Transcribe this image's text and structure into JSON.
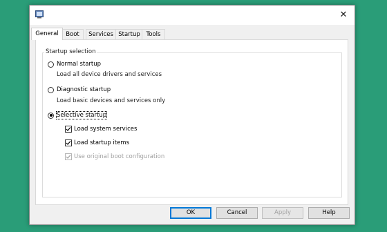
{
  "window": {
    "close_glyph": "✕"
  },
  "tabs": [
    {
      "label": "General",
      "active": true
    },
    {
      "label": "Boot",
      "active": false
    },
    {
      "label": "Services",
      "active": false
    },
    {
      "label": "Startup",
      "active": false
    },
    {
      "label": "Tools",
      "active": false
    }
  ],
  "startup_selection": {
    "group_title": "Startup selection",
    "normal": {
      "label": "Normal startup",
      "description": "Load all device drivers and services",
      "selected": false
    },
    "diagnostic": {
      "label": "Diagnostic startup",
      "description": "Load basic devices and services only",
      "selected": false
    },
    "selective": {
      "label": "Selective startup",
      "selected": true
    },
    "options": {
      "load_system_services": {
        "label": "Load system services",
        "checked": true,
        "enabled": true
      },
      "load_startup_items": {
        "label": "Load startup items",
        "checked": true,
        "enabled": true
      },
      "use_original_boot": {
        "label": "Use original boot configuration",
        "checked": true,
        "enabled": false
      }
    }
  },
  "buttons": {
    "ok": "OK",
    "cancel": "Cancel",
    "apply": "Apply",
    "help": "Help"
  },
  "colors": {
    "background": "#2a9d78",
    "accent": "#0078d7"
  }
}
